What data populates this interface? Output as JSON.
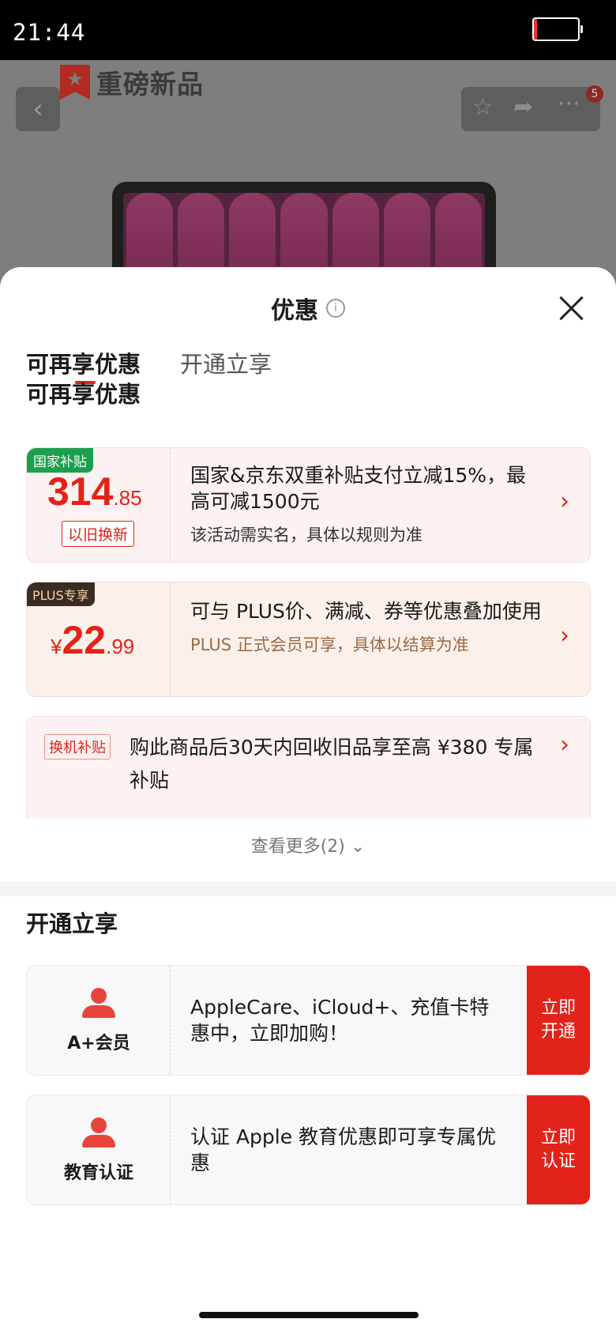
{
  "status": {
    "time": "21:44"
  },
  "background": {
    "brand": "重磅新品",
    "cart_badge": "5"
  },
  "sheet": {
    "title": "优惠",
    "tabs": [
      "可再享优惠",
      "开通立享"
    ],
    "section1_title": "可再享优惠",
    "cards": [
      {
        "tag": "国家补贴",
        "price_int": "314",
        "price_dec": ".85",
        "sub_tag": "以旧换新",
        "main": "国家&京东双重补贴支付立减15%，最高可减1500元",
        "sub": "该活动需实名，具体以规则为准"
      },
      {
        "tag": "PLUS专享",
        "price_int": "22",
        "price_dec": ".99",
        "currency": "¥",
        "main": "可与 PLUS价、满减、券等优惠叠加使用",
        "sub": "PLUS 正式会员可享，具体以结算为准"
      },
      {
        "tag": "换机补贴",
        "main": "购此商品后30天内回收旧品享至高 ¥380 专属补贴"
      }
    ],
    "more": "查看更多(2)",
    "section2_title": "开通立享",
    "open_cards": [
      {
        "label": "A+会员",
        "main": "AppleCare、iCloud+、充值卡特惠中，立即加购！",
        "button": "立即开通"
      },
      {
        "label": "教育认证",
        "main": "认证 Apple 教育优惠即可享专属优惠",
        "button": "立即认证"
      }
    ]
  },
  "colors": {
    "accent": "#e2231a",
    "green_tag": "#1aa04d",
    "plus_tag": "#3a2b24"
  }
}
